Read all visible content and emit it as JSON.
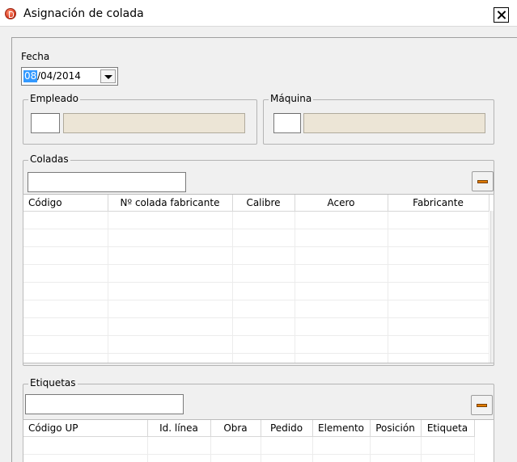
{
  "window": {
    "title": "Asignación de colada",
    "icon": "app-logo-icon",
    "close_icon": "close-icon"
  },
  "fecha": {
    "label": "Fecha",
    "day_selected": "08",
    "rest": "/04/2014"
  },
  "empleado": {
    "label": "Empleado",
    "code": "",
    "description": ""
  },
  "maquina": {
    "label": "Máquina",
    "code": "",
    "description": ""
  },
  "coladas": {
    "label": "Coladas",
    "search_value": "",
    "columns": [
      "Código",
      "Nº colada fabricante",
      "Calibre",
      "Acero",
      "Fabricante"
    ],
    "rows": []
  },
  "etiquetas": {
    "label": "Etiquetas",
    "search_value": "",
    "columns": [
      "Código UP",
      "Id. línea",
      "Obra",
      "Pedido",
      "Elemento",
      "Posición",
      "Etiqueta"
    ],
    "rows": []
  },
  "colors": {
    "accent_selection": "#3399ff",
    "readonly_field": "#ece5d6",
    "remove_button": "#e07b00"
  }
}
